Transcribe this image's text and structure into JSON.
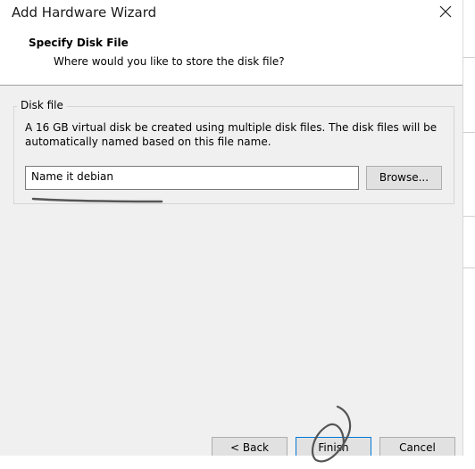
{
  "window": {
    "title": "Add Hardware Wizard"
  },
  "header": {
    "title": "Specify Disk File",
    "subtitle": "Where would you like to store the disk file?"
  },
  "disk_file_group": {
    "legend": "Disk file",
    "description": "A 16 GB virtual disk be created using multiple disk files. The disk files will be automatically named based on this file name.",
    "input_value": "Name it debian",
    "browse_label": "Browse..."
  },
  "footer": {
    "back_label": "< Back",
    "finish_label": "Finish",
    "cancel_label": "Cancel"
  },
  "icons": {
    "close": "close-icon"
  },
  "colors": {
    "dialog_bg": "#f0f0f0",
    "header_bg": "#ffffff",
    "button_bg": "#e1e1e1",
    "default_button_border": "#0078d7",
    "annotation_ink": "#555555"
  }
}
